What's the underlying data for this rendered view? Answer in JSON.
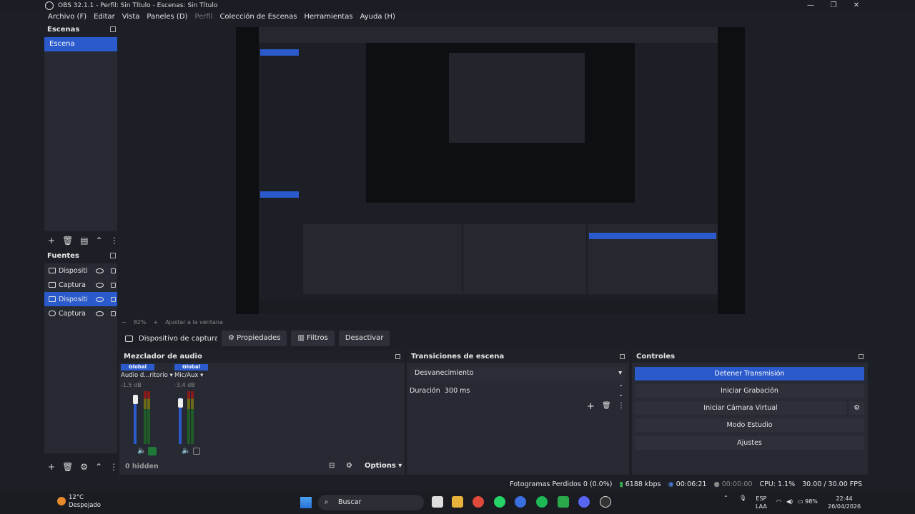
{
  "window": {
    "title": "OBS 32.1.1 - Perfil: Sin Título - Escenas: Sin Título"
  },
  "menu": [
    "Archivo (F)",
    "Editar",
    "Vista",
    "Paneles (D)",
    "Perfil",
    "Colección de Escenas",
    "Herramientas",
    "Ayuda (H)"
  ],
  "scenes": {
    "title": "Escenas",
    "items": [
      "Escena"
    ]
  },
  "sources": {
    "title": "Fuentes",
    "items": [
      {
        "label": "Dispositiv",
        "icon": "camera-icon"
      },
      {
        "label": "Captura d",
        "icon": "monitor-icon"
      },
      {
        "label": "Dispositiv",
        "icon": "camera-icon",
        "selected": true
      },
      {
        "label": "Captura d",
        "icon": "gamepad-icon"
      }
    ]
  },
  "zoom": {
    "minus": "−",
    "value": "82%",
    "plus": "+",
    "fit": "Ajustar a la ventana"
  },
  "source_toolbar": {
    "name": "Dispositivo de captura de v",
    "properties": "Propiedades",
    "filters": "Filtros",
    "deactivate": "Desactivar"
  },
  "mixer": {
    "title": "Mezclador de audio",
    "channels": [
      {
        "badge": "Global",
        "name": "Audio d...ritorio",
        "db": "-1.5 dB"
      },
      {
        "badge": "Global",
        "name": "Mic/Aux",
        "db": "-3.4 dB"
      }
    ],
    "hidden": "0 hidden",
    "options": "Options"
  },
  "transitions": {
    "title": "Transiciones de escena",
    "selected": "Desvanecimiento",
    "duration_label": "Duración",
    "duration_value": "300 ms"
  },
  "controls": {
    "title": "Controles",
    "buttons": [
      "Detener Transmisión",
      "Iniciar Grabación",
      "Iniciar Cámara Virtual",
      "Modo Estudio",
      "Ajustes"
    ]
  },
  "status": {
    "dropped": "Fotogramas Perdidos 0 (0.0%)",
    "bitrate": "6188 kbps",
    "stream_time": "00:06:21",
    "rec_time": "00:00:00",
    "cpu": "CPU: 1.1%",
    "fps": "30.00 / 30.00 FPS"
  },
  "taskbar": {
    "weather_temp": "12°C",
    "weather_desc": "Despejado",
    "search": "Buscar",
    "lang_top": "ESP",
    "lang_bottom": "LAA",
    "battery": "98%",
    "time": "22:44",
    "date": "26/04/2026"
  },
  "colors": {
    "accent": "#2a5acb",
    "background": "#1d1f26",
    "panel": "#272a33"
  }
}
